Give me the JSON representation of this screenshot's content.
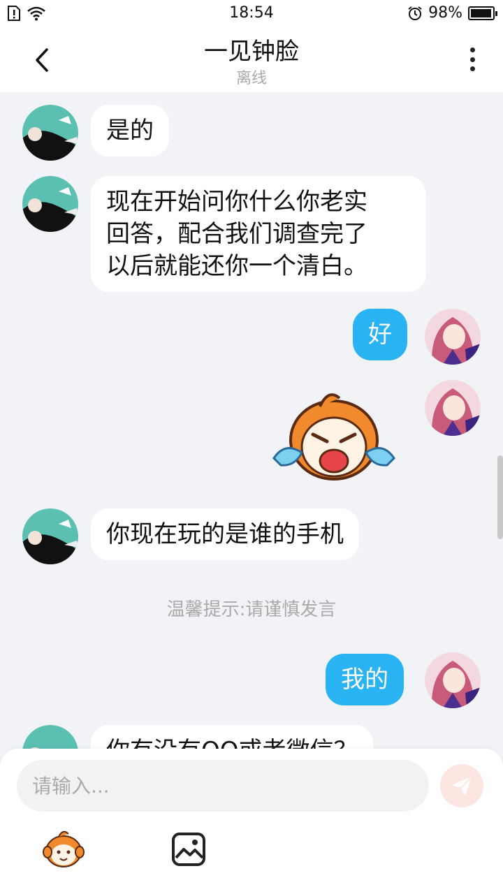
{
  "status_bar": {
    "time": "18:54",
    "battery": "98%",
    "battery_level": 0.98
  },
  "header": {
    "title": "一见钟脸",
    "subtitle": "离线"
  },
  "messages": [
    {
      "side": "in",
      "text": "是的"
    },
    {
      "side": "in",
      "lines": [
        "现在开始问你什么你老实",
        "回答，配合我们调查完了",
        "以后就能还你一个清白。"
      ]
    },
    {
      "side": "out",
      "text": "好"
    },
    {
      "side": "out",
      "sticker": "crying-mascot-sticker"
    },
    {
      "side": "in",
      "text": "你现在玩的是谁的手机"
    },
    {
      "side": "out",
      "text": "我的"
    },
    {
      "side": "in",
      "text": "你有没有QQ或者微信？"
    }
  ],
  "hint": "温馨提示:请谨慎发言",
  "input": {
    "placeholder": "请输入..."
  },
  "colors": {
    "accent": "#2ab3f2",
    "chat_bg": "#f2f3f7",
    "send_button": "#fde6e2"
  }
}
